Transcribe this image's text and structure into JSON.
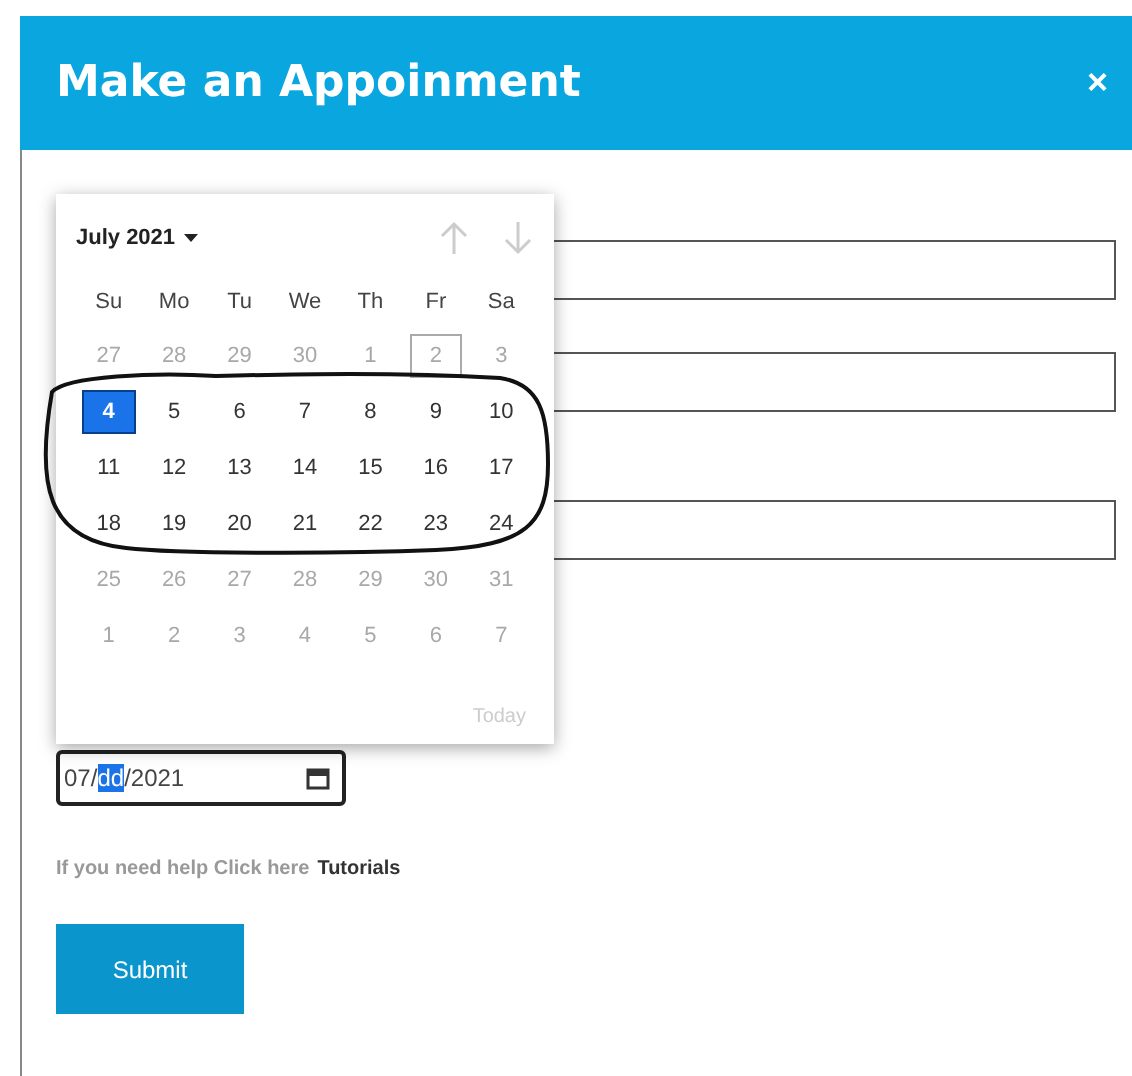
{
  "dialog": {
    "title": "Make an Appoinment",
    "close": "×"
  },
  "fields": [
    {
      "kind": "text"
    },
    {
      "kind": "text"
    },
    {
      "kind": "text"
    }
  ],
  "calendar": {
    "month": "July 2021",
    "prev_disabled": true,
    "next_disabled": true,
    "weekdays": [
      "Su",
      "Mo",
      "Tu",
      "We",
      "Th",
      "Fr",
      "Sa"
    ],
    "weeks": [
      [
        {
          "label": "27",
          "disabled": true,
          "selected": false,
          "today": false
        },
        {
          "label": "28",
          "disabled": true,
          "selected": false,
          "today": false
        },
        {
          "label": "29",
          "disabled": true,
          "selected": false,
          "today": false
        },
        {
          "label": "30",
          "disabled": true,
          "selected": false,
          "today": false
        },
        {
          "label": "1",
          "disabled": true,
          "selected": false,
          "today": false
        },
        {
          "label": "2",
          "disabled": true,
          "selected": false,
          "today": true
        },
        {
          "label": "3",
          "disabled": true,
          "selected": false,
          "today": false
        }
      ],
      [
        {
          "label": "4",
          "disabled": false,
          "selected": true,
          "today": false
        },
        {
          "label": "5",
          "disabled": false,
          "selected": false,
          "today": false
        },
        {
          "label": "6",
          "disabled": false,
          "selected": false,
          "today": false
        },
        {
          "label": "7",
          "disabled": false,
          "selected": false,
          "today": false
        },
        {
          "label": "8",
          "disabled": false,
          "selected": false,
          "today": false
        },
        {
          "label": "9",
          "disabled": false,
          "selected": false,
          "today": false
        },
        {
          "label": "10",
          "disabled": false,
          "selected": false,
          "today": false
        }
      ],
      [
        {
          "label": "11",
          "disabled": false,
          "selected": false,
          "today": false
        },
        {
          "label": "12",
          "disabled": false,
          "selected": false,
          "today": false
        },
        {
          "label": "13",
          "disabled": false,
          "selected": false,
          "today": false
        },
        {
          "label": "14",
          "disabled": false,
          "selected": false,
          "today": false
        },
        {
          "label": "15",
          "disabled": false,
          "selected": false,
          "today": false
        },
        {
          "label": "16",
          "disabled": false,
          "selected": false,
          "today": false
        },
        {
          "label": "17",
          "disabled": false,
          "selected": false,
          "today": false
        }
      ],
      [
        {
          "label": "18",
          "disabled": false,
          "selected": false,
          "today": false
        },
        {
          "label": "19",
          "disabled": false,
          "selected": false,
          "today": false
        },
        {
          "label": "20",
          "disabled": false,
          "selected": false,
          "today": false
        },
        {
          "label": "21",
          "disabled": false,
          "selected": false,
          "today": false
        },
        {
          "label": "22",
          "disabled": false,
          "selected": false,
          "today": false
        },
        {
          "label": "23",
          "disabled": false,
          "selected": false,
          "today": false
        },
        {
          "label": "24",
          "disabled": false,
          "selected": false,
          "today": false
        }
      ],
      [
        {
          "label": "25",
          "disabled": true,
          "selected": false,
          "today": false
        },
        {
          "label": "26",
          "disabled": true,
          "selected": false,
          "today": false
        },
        {
          "label": "27",
          "disabled": true,
          "selected": false,
          "today": false
        },
        {
          "label": "28",
          "disabled": true,
          "selected": false,
          "today": false
        },
        {
          "label": "29",
          "disabled": true,
          "selected": false,
          "today": false
        },
        {
          "label": "30",
          "disabled": true,
          "selected": false,
          "today": false
        },
        {
          "label": "31",
          "disabled": true,
          "selected": false,
          "today": false
        }
      ],
      [
        {
          "label": "1",
          "disabled": true,
          "selected": false,
          "today": false
        },
        {
          "label": "2",
          "disabled": true,
          "selected": false,
          "today": false
        },
        {
          "label": "3",
          "disabled": true,
          "selected": false,
          "today": false
        },
        {
          "label": "4",
          "disabled": true,
          "selected": false,
          "today": false
        },
        {
          "label": "5",
          "disabled": true,
          "selected": false,
          "today": false
        },
        {
          "label": "6",
          "disabled": true,
          "selected": false,
          "today": false
        },
        {
          "label": "7",
          "disabled": true,
          "selected": false,
          "today": false
        }
      ]
    ],
    "today_button": {
      "label": "Today",
      "disabled": true
    }
  },
  "date_field": {
    "segments": [
      {
        "text": "07",
        "selected": false
      },
      {
        "text": "/",
        "selected": false
      },
      {
        "text": "dd",
        "selected": true
      },
      {
        "text": "/",
        "selected": false
      },
      {
        "text": "2021",
        "selected": false
      }
    ]
  },
  "help": {
    "text": "If you need help Click here",
    "link": "Tutorials"
  },
  "submit": {
    "label": "Submit"
  }
}
